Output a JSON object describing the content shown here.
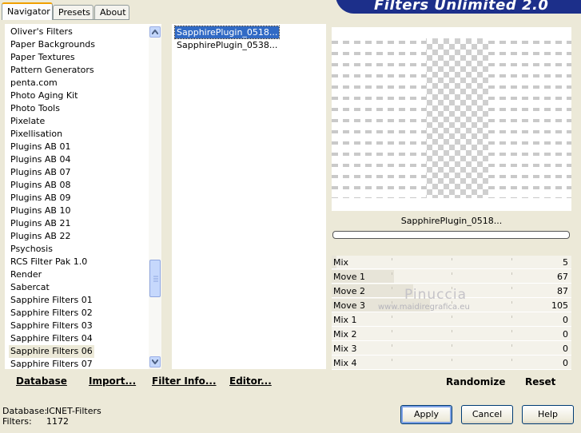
{
  "tabs": [
    "Navigator",
    "Presets",
    "About"
  ],
  "app_title": "Filters Unlimited 2.0",
  "categories": [
    "Oliver's Filters",
    "Paper Backgrounds",
    "Paper Textures",
    "Pattern Generators",
    "penta.com",
    "Photo Aging Kit",
    "Photo Tools",
    "Pixelate",
    "Pixellisation",
    "Plugins AB 01",
    "Plugins AB 04",
    "Plugins AB 07",
    "Plugins AB 08",
    "Plugins AB 09",
    "Plugins AB 10",
    "Plugins AB 21",
    "Plugins AB 22",
    "Psychosis",
    "RCS Filter Pak 1.0",
    "Render",
    "Sabercat",
    "Sapphire Filters 01",
    "Sapphire Filters 02",
    "Sapphire Filters 03",
    "Sapphire Filters 04",
    "Sapphire Filters 06",
    "Sapphire Filters 07"
  ],
  "selected_category": "Sapphire Filters 06",
  "filters": [
    "SapphirePlugin_0518...",
    "SapphirePlugin_0538..."
  ],
  "selected_filter": "SapphirePlugin_0518...",
  "links": {
    "database": "Database",
    "import": "Import...",
    "filter_info": "Filter Info...",
    "editor": "Editor..."
  },
  "preview_label": "SapphirePlugin_0518...",
  "params": [
    {
      "name": "Mix",
      "value": "5"
    },
    {
      "name": "Move 1",
      "value": "67"
    },
    {
      "name": "Move 2",
      "value": "87"
    },
    {
      "name": "Move 3",
      "value": "105"
    },
    {
      "name": "Mix 1",
      "value": "0"
    },
    {
      "name": "Mix 2",
      "value": "0"
    },
    {
      "name": "Mix 3",
      "value": "0"
    },
    {
      "name": "Mix 4",
      "value": "0"
    }
  ],
  "param_fill": [
    0.02,
    0.26,
    0.34,
    0.41,
    0,
    0,
    0,
    0
  ],
  "watermark": {
    "name": "Pinuccia",
    "url": "www.maidiregrafica.eu"
  },
  "randomize": "Randomize",
  "reset": "Reset",
  "info": {
    "database_label": "Database:",
    "database_value": "ICNET-Filters",
    "filters_label": "Filters:",
    "filters_value": "1172"
  },
  "buttons": {
    "apply": "Apply",
    "cancel": "Cancel",
    "help": "Help"
  },
  "colors": {
    "accent": "#1c2f8a",
    "selection": "#316ac5",
    "tab_highlight": "#f0a000"
  }
}
